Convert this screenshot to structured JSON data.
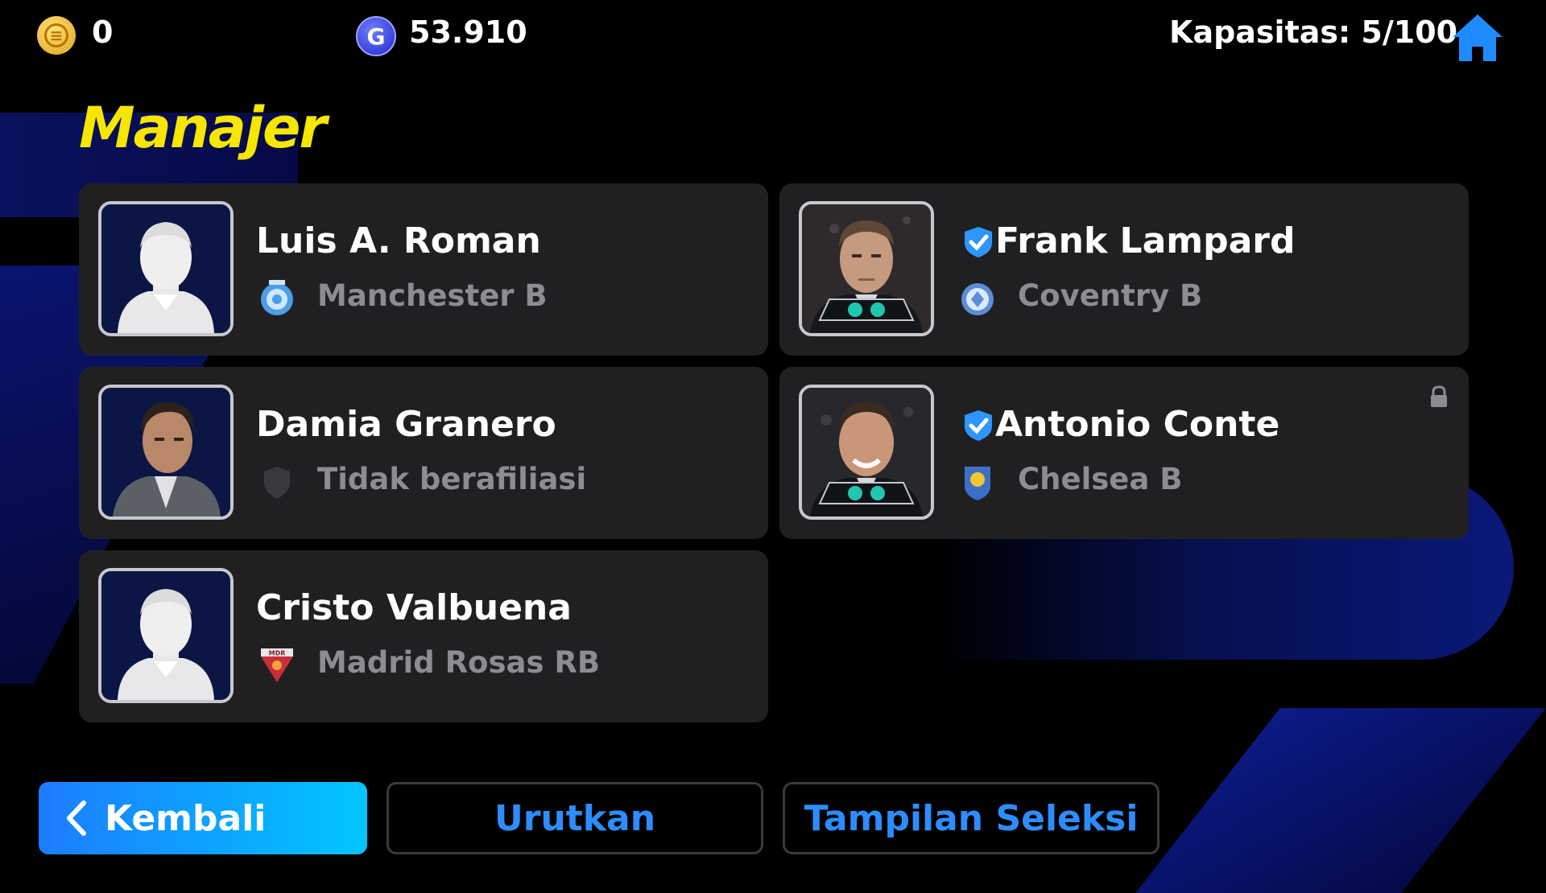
{
  "currency": {
    "coins": "0",
    "gp": "53.910",
    "gp_symbol": "G"
  },
  "capacity_label": "Kapasitas: 5/100",
  "page_title": "Manajer",
  "managers": [
    {
      "name": "Luis A. Roman",
      "club": "Manchester B",
      "verified": false,
      "locked": false,
      "avatar": "silhouette-icon",
      "badge": "manchester-b-badge-icon"
    },
    {
      "name": "Frank Lampard",
      "club": "Coventry B",
      "verified": true,
      "locked": false,
      "avatar": "manager-photo",
      "badge": "coventry-b-badge-icon"
    },
    {
      "name": "Damia Granero",
      "club": "Tidak berafiliasi",
      "verified": false,
      "locked": false,
      "avatar": "manager-portrait",
      "badge": "no-affiliation-shield-icon"
    },
    {
      "name": "Antonio Conte",
      "club": "Chelsea B",
      "verified": true,
      "locked": true,
      "avatar": "manager-photo",
      "badge": "chelsea-b-badge-icon"
    },
    {
      "name": "Cristo Valbuena",
      "club": "Madrid Rosas RB",
      "verified": false,
      "locked": false,
      "avatar": "silhouette-icon",
      "badge": "madrid-rosas-badge-icon",
      "badge_text": "MDR"
    }
  ],
  "buttons": {
    "back": "Kembali",
    "sort": "Urutkan",
    "view": "Tampilan Seleksi"
  },
  "colors": {
    "title": "#f6e600",
    "accent": "#2d8dff",
    "card": "#202022"
  }
}
